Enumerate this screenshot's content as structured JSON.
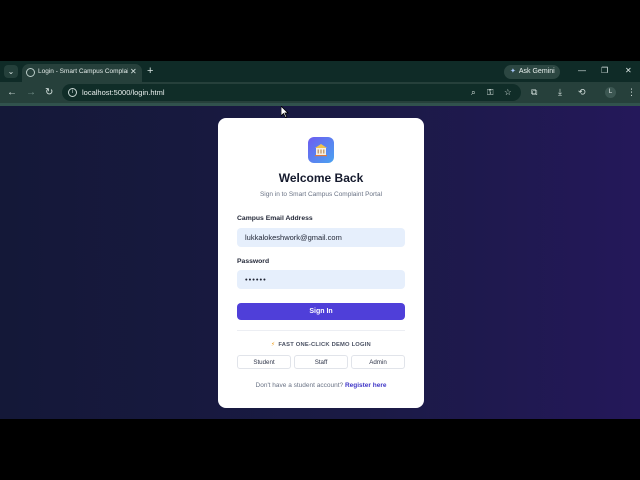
{
  "browser": {
    "tab_title": "Login - Smart Campus Complaint",
    "tab_close": "✕",
    "new_tab": "+",
    "ask_gemini": "Ask Gemini",
    "url": "localhost:5000/login.html",
    "profile_initial": "L",
    "minimize": "—",
    "restore": "❐",
    "close": "✕"
  },
  "login": {
    "title": "Welcome Back",
    "subtitle": "Sign in to Smart Campus Complaint Portal",
    "email_label": "Campus Email Address",
    "email_value": "lukkalokeshwork@gmail.com",
    "password_label": "Password",
    "password_value": "••••••",
    "sign_in_label": "Sign In",
    "demo_label": "FAST ONE-CLICK DEMO LOGIN",
    "demo_buttons": [
      "Student",
      "Staff",
      "Admin"
    ],
    "register_prompt": "Don't have a student account?",
    "register_link": "Register here"
  },
  "colors": {
    "accent": "#4f3fd9",
    "input_bg": "#e6effc",
    "page_bg_left": "#141838",
    "page_bg_right": "#24185a",
    "browser_chrome": "#26403b"
  },
  "icons": [
    "tab-list-icon",
    "globe-icon",
    "gemini-spark-icon",
    "back-icon",
    "forward-icon",
    "reload-icon",
    "site-info-icon",
    "zoom-icon",
    "password-key-icon",
    "bookmark-star-icon",
    "extensions-icon",
    "download-icon",
    "history-icon",
    "kebab-menu-icon",
    "campus-building-icon",
    "bolt-icon"
  ]
}
